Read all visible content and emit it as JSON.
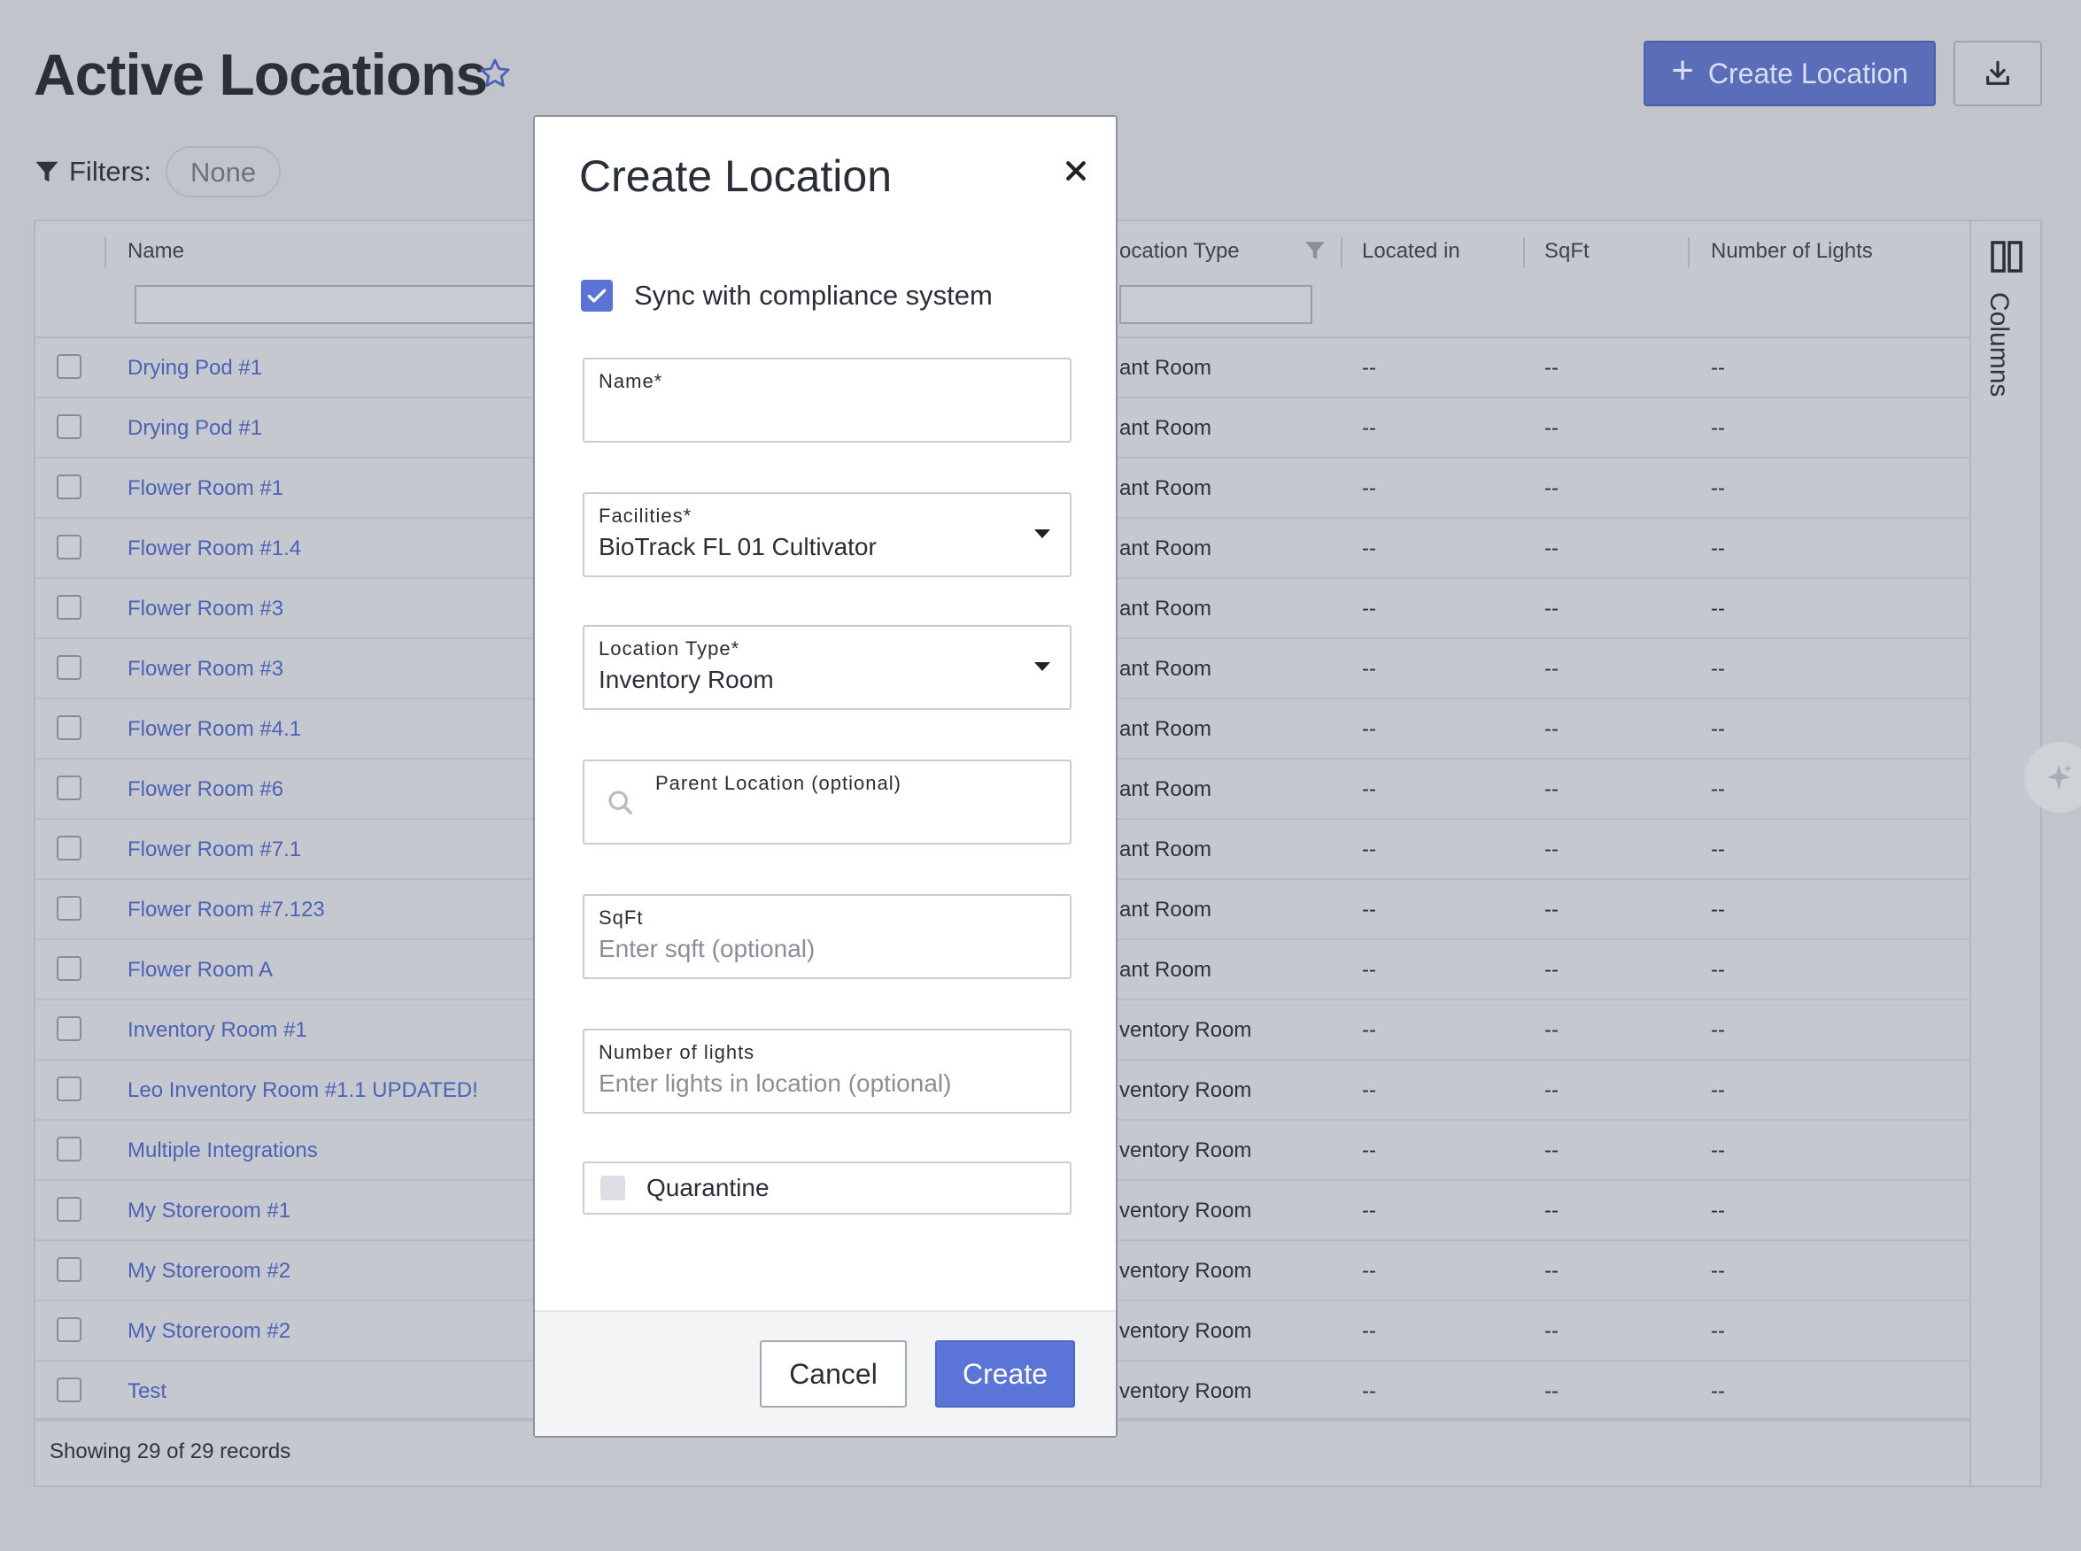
{
  "page": {
    "title": "Active Locations",
    "create_button": "Create Location",
    "filters_label": "Filters:",
    "filters_value": "None"
  },
  "grid": {
    "columns": [
      "Name",
      "ocation Type",
      "Located in",
      "SqFt",
      "Number of Lights"
    ],
    "side_panel_label": "Columns",
    "rows": [
      {
        "name": "Drying Pod #1",
        "type": "ant Room",
        "located_in": "--",
        "sqft": "--",
        "lights": "--"
      },
      {
        "name": "Drying Pod #1",
        "type": "ant Room",
        "located_in": "--",
        "sqft": "--",
        "lights": "--"
      },
      {
        "name": "Flower Room #1",
        "type": "ant Room",
        "located_in": "--",
        "sqft": "--",
        "lights": "--"
      },
      {
        "name": "Flower Room #1.4",
        "type": "ant Room",
        "located_in": "--",
        "sqft": "--",
        "lights": "--"
      },
      {
        "name": "Flower Room #3",
        "type": "ant Room",
        "located_in": "--",
        "sqft": "--",
        "lights": "--"
      },
      {
        "name": "Flower Room #3",
        "type": "ant Room",
        "located_in": "--",
        "sqft": "--",
        "lights": "--"
      },
      {
        "name": "Flower Room #4.1",
        "type": "ant Room",
        "located_in": "--",
        "sqft": "--",
        "lights": "--"
      },
      {
        "name": "Flower Room #6",
        "type": "ant Room",
        "located_in": "--",
        "sqft": "--",
        "lights": "--"
      },
      {
        "name": "Flower Room #7.1",
        "type": "ant Room",
        "located_in": "--",
        "sqft": "--",
        "lights": "--"
      },
      {
        "name": "Flower Room #7.123",
        "type": "ant Room",
        "located_in": "--",
        "sqft": "--",
        "lights": "--"
      },
      {
        "name": "Flower Room A",
        "type": "ant Room",
        "located_in": "--",
        "sqft": "--",
        "lights": "--"
      },
      {
        "name": "Inventory Room #1",
        "type": "ventory Room",
        "located_in": "--",
        "sqft": "--",
        "lights": "--"
      },
      {
        "name": "Leo Inventory Room #1.1 UPDATED!",
        "type": "ventory Room",
        "located_in": "--",
        "sqft": "--",
        "lights": "--"
      },
      {
        "name": "Multiple Integrations",
        "type": "ventory Room",
        "located_in": "--",
        "sqft": "--",
        "lights": "--"
      },
      {
        "name": "My Storeroom #1",
        "type": "ventory Room",
        "located_in": "--",
        "sqft": "--",
        "lights": "--"
      },
      {
        "name": "My Storeroom #2",
        "type": "ventory Room",
        "located_in": "--",
        "sqft": "--",
        "lights": "--"
      },
      {
        "name": "My Storeroom #2",
        "type": "ventory Room",
        "located_in": "--",
        "sqft": "--",
        "lights": "--"
      },
      {
        "name": "Test",
        "type": "ventory Room",
        "located_in": "--",
        "sqft": "--",
        "lights": "--"
      }
    ],
    "footer": "Showing 29 of 29 records"
  },
  "modal": {
    "title": "Create Location",
    "sync_label": "Sync with compliance system",
    "sync_checked": true,
    "name": {
      "label": "Name*",
      "value": ""
    },
    "facilities": {
      "label": "Facilities*",
      "value": "BioTrack FL 01 Cultivator"
    },
    "location_type": {
      "label": "Location Type*",
      "value": "Inventory Room"
    },
    "parent": {
      "label": "Parent Location (optional)",
      "value": ""
    },
    "sqft": {
      "label": "SqFt",
      "placeholder": "Enter sqft (optional)"
    },
    "lights": {
      "label": "Number of lights",
      "placeholder": "Enter lights in location (optional)"
    },
    "quarantine_label": "Quarantine",
    "quarantine_checked": false,
    "cancel": "Cancel",
    "submit": "Create"
  },
  "colors": {
    "accent": "#5b74d8",
    "link": "#4b62b6",
    "backdrop": "#c1c4cb"
  }
}
